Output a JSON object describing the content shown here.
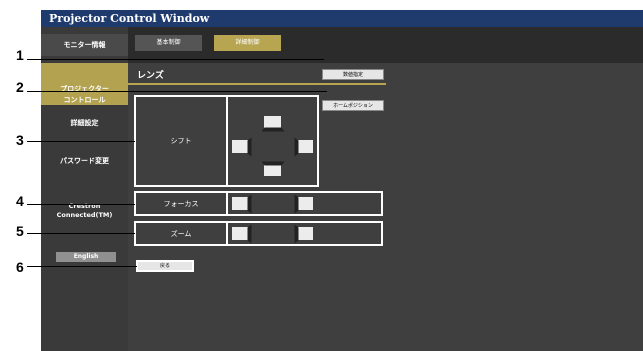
{
  "window": {
    "title": "Projector Control Window"
  },
  "sidebar": {
    "items": [
      {
        "label": "モニター情報"
      },
      {
        "label": "プロジェクター\nコントロール"
      },
      {
        "label": "詳細設定"
      },
      {
        "label": "パスワード変更"
      },
      {
        "label": "Crestron\nConnected(TM)"
      }
    ],
    "language_button": "English"
  },
  "tabs": {
    "basic": "基本制御",
    "detail": "詳細制御"
  },
  "page": {
    "title": "レンズ",
    "numeric_button": "数値指定",
    "home_position_button": "ホームポジション",
    "shift_label": "シフト",
    "focus_label": "フォーカス",
    "zoom_label": "ズーム",
    "back_button": "戻る"
  },
  "callouts": [
    "1",
    "2",
    "3",
    "4",
    "5",
    "6"
  ]
}
